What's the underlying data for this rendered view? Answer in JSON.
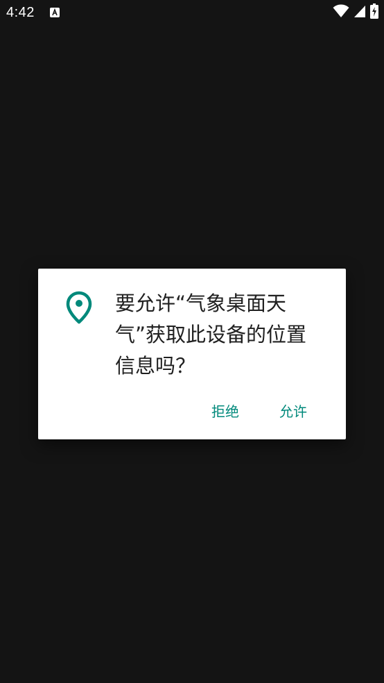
{
  "status_bar": {
    "time": "4:42",
    "icons": [
      "app-notification-icon",
      "wifi-icon",
      "cellular-signal-icon",
      "battery-charging-icon"
    ]
  },
  "dialog": {
    "icon": "location-pin-icon",
    "message": "要允许“气象桌面天气”获取此设备的位置信息吗？",
    "deny_label": "拒绝",
    "allow_label": "允许"
  },
  "colors": {
    "background": "#141414",
    "dialog_background": "#ffffff",
    "accent": "#00897b",
    "text": "#202020"
  }
}
